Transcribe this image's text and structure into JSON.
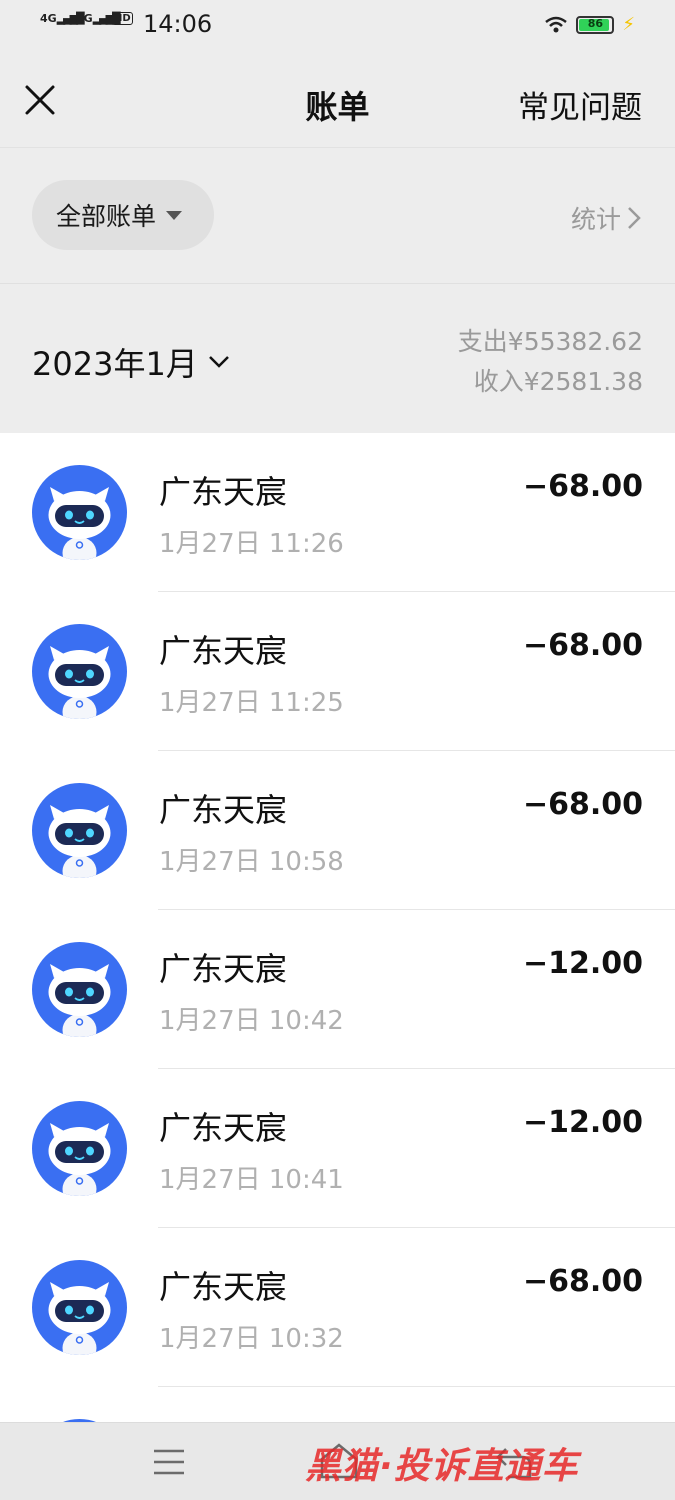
{
  "status_bar": {
    "sig1_label": "4G",
    "sig2_label": "5G",
    "hd_label": "HD",
    "time": "14:06",
    "battery": "86"
  },
  "nav": {
    "title": "账单",
    "faq_label": "常见问题"
  },
  "filter": {
    "label": "全部账单",
    "stats_label": "统计"
  },
  "summary": {
    "month": "2023年1月",
    "expense": "支出¥55382.62",
    "income": "收入¥2581.38"
  },
  "transactions": [
    {
      "merchant": "广东天宸",
      "time": "1月27日 11:26",
      "amount": "−68.00"
    },
    {
      "merchant": "广东天宸",
      "time": "1月27日 11:25",
      "amount": "−68.00"
    },
    {
      "merchant": "广东天宸",
      "time": "1月27日 10:58",
      "amount": "−68.00"
    },
    {
      "merchant": "广东天宸",
      "time": "1月27日 10:42",
      "amount": "−12.00"
    },
    {
      "merchant": "广东天宸",
      "time": "1月27日 10:41",
      "amount": "−12.00"
    },
    {
      "merchant": "广东天宸",
      "time": "1月27日 10:32",
      "amount": "−68.00"
    }
  ],
  "watermark": "黑猫·投诉直通车",
  "colors": {
    "background": "#ededed",
    "list_bg": "#ffffff",
    "avatar_blue": "#3a6ff2",
    "muted_text": "#9a9a9a",
    "battery_green": "#30d158"
  },
  "icons": [
    "close-icon",
    "caret-down-icon",
    "chevron-right-icon",
    "chevron-down-icon",
    "robot-avatar",
    "wifi-icon",
    "battery-icon",
    "charging-icon",
    "menu-icon",
    "home-icon",
    "back-icon"
  ]
}
